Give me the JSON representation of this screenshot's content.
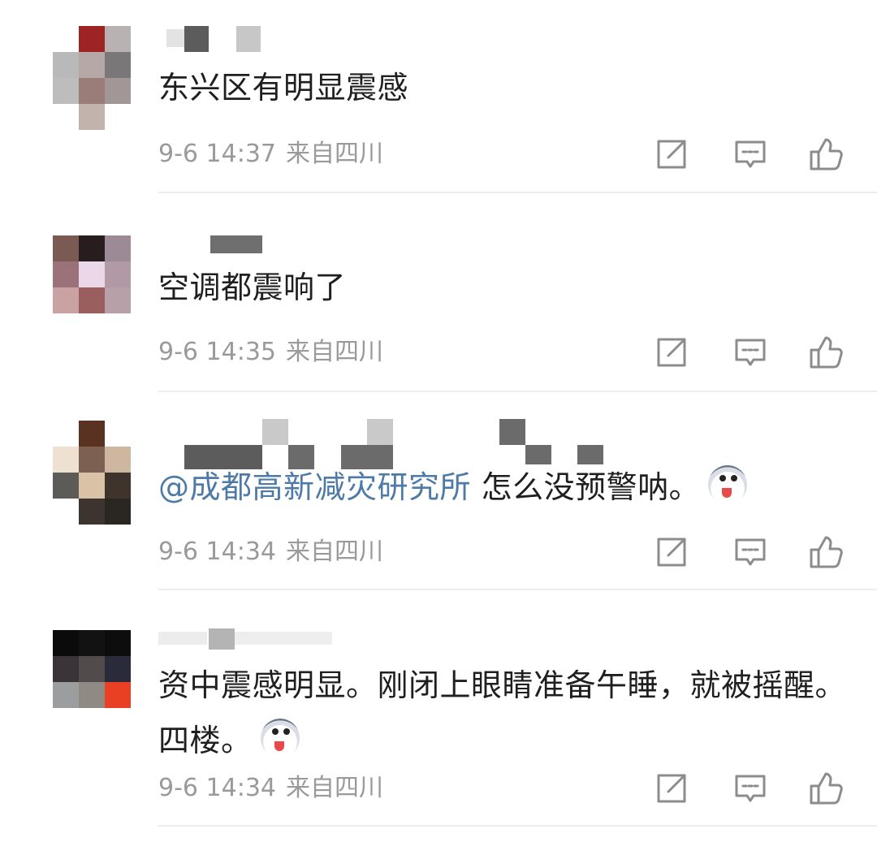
{
  "comments": [
    {
      "text": "东兴区有明显震感",
      "time": "9-6 14:37",
      "location": "来自四川"
    },
    {
      "text": "空调都震响了",
      "time": "9-6 14:35",
      "location": "来自四川"
    },
    {
      "mention": "@成都高新减灾研究所",
      "text": " 怎么没预警呐。",
      "emoji_icon": "husky-emoji-icon",
      "time": "9-6 14:34",
      "location": "来自四川"
    },
    {
      "text": "资中震感明显。刚闭上眼睛准备午睡，就被摇醒。四楼。",
      "emoji_icon": "husky-emoji-icon",
      "time": "9-6 14:34",
      "location": "来自四川"
    }
  ],
  "action_icons": [
    "share-icon",
    "comment-icon",
    "like-icon"
  ],
  "colors": {
    "mention": "#4e7aa8",
    "meta_text": "#9a9a9a",
    "icon_stroke": "#8c8c8c",
    "divider": "#ececec"
  }
}
